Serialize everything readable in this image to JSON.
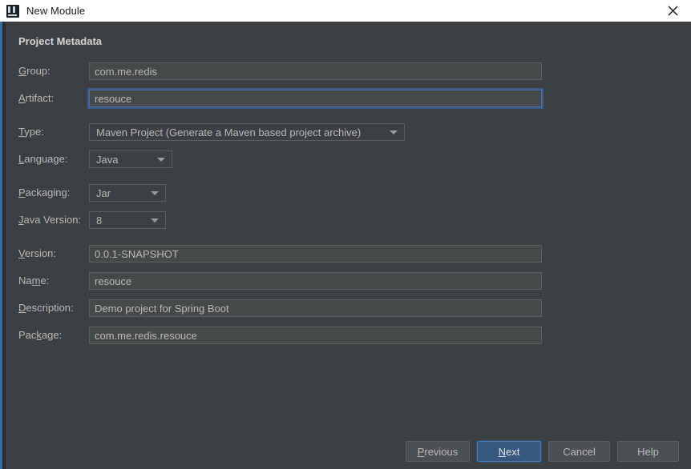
{
  "window": {
    "title": "New Module",
    "icon": "intellij-idea-icon",
    "close_icon": "close-icon",
    "accent_color": "#2d6ca2",
    "background": "#3c3f41"
  },
  "form": {
    "section_title": "Project Metadata",
    "fields": [
      {
        "id": "group",
        "label": "Group:",
        "mnemonic": "G",
        "kind": "text",
        "value": "com.me.redis",
        "focused": false
      },
      {
        "id": "artifact",
        "label": "Artifact:",
        "mnemonic": "A",
        "kind": "text",
        "value": "resouce",
        "focused": true
      },
      {
        "id": "type",
        "label": "Type:",
        "mnemonic": "T",
        "kind": "combo",
        "value": "Maven Project (Generate a Maven based project archive)"
      },
      {
        "id": "language",
        "label": "Language:",
        "mnemonic": "L",
        "kind": "combo",
        "value": "Java"
      },
      {
        "id": "packaging",
        "label": "Packaging:",
        "mnemonic": "P",
        "kind": "combo",
        "value": "Jar"
      },
      {
        "id": "java-version",
        "label": "Java Version:",
        "mnemonic": "J",
        "kind": "combo",
        "value": "8"
      },
      {
        "id": "version",
        "label": "Version:",
        "mnemonic": "V",
        "kind": "text",
        "value": "0.0.1-SNAPSHOT",
        "focused": false
      },
      {
        "id": "name",
        "label": "Name:",
        "mnemonic": "m",
        "kind": "text",
        "value": "resouce",
        "focused": false
      },
      {
        "id": "description",
        "label": "Description:",
        "mnemonic": "D",
        "kind": "text",
        "value": "Demo project for Spring Boot",
        "focused": false
      },
      {
        "id": "package",
        "label": "Package:",
        "mnemonic": "k",
        "kind": "text",
        "value": "com.me.redis.resouce",
        "focused": false
      }
    ]
  },
  "buttons": {
    "previous": "Previous",
    "next": "Next",
    "cancel": "Cancel",
    "help": "Help",
    "default_button": "Next"
  }
}
